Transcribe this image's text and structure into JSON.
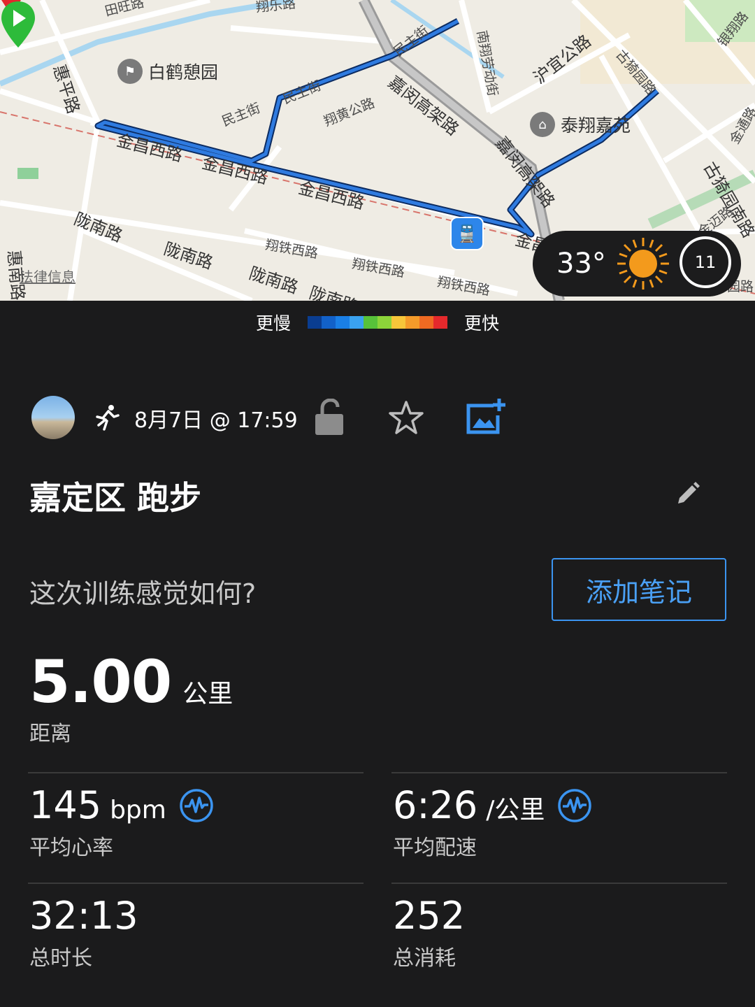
{
  "map": {
    "labels": [
      "田旺路",
      "翔乐路",
      "惠平路",
      "民主街",
      "民主街",
      "民主街",
      "翔黄公路",
      "嘉闵高架路",
      "南翔劳动街",
      "沪宜公路",
      "古猗园路",
      "银翔路",
      "金通路",
      "古猗园南路",
      "金迈路",
      "金昌西路",
      "金昌西路",
      "金昌西路",
      "金昌",
      "陇南路",
      "陇南路",
      "陇南路",
      "陇南路",
      "翔铁西路",
      "翔铁西路",
      "翔铁西路",
      "惠南路",
      "嘉闵高架路",
      "园路"
    ],
    "poi_baihe": "白鹤憩园",
    "poi_taixiang": "泰翔嘉苑",
    "legal": "法律信息",
    "route_color": "#1d5fc4"
  },
  "weather": {
    "temperature": "33°",
    "wind": "11",
    "icon": "sun-icon"
  },
  "pace_scale": {
    "slower": "更慢",
    "faster": "更快",
    "colors": [
      "#0a3d91",
      "#1261c9",
      "#1a7fe6",
      "#3aa2f0",
      "#57c23a",
      "#8cd43a",
      "#f7c63a",
      "#f59b2a",
      "#ef6a22",
      "#e5292c"
    ]
  },
  "activity": {
    "date_time": "8月7日 @ 17:59",
    "title": "嘉定区 跑步",
    "feel_prompt": "这次训练感觉如何?",
    "add_note": "添加笔记",
    "distance": {
      "value": "5.00",
      "unit": "公里",
      "label": "距离"
    },
    "stats": [
      {
        "value": "145",
        "unit": "bpm",
        "label": "平均心率",
        "icon": "heart-rate-icon"
      },
      {
        "value": "6:26",
        "unit": "/公里",
        "label": "平均配速",
        "icon": "heart-rate-icon"
      },
      {
        "value": "32:13",
        "unit": "",
        "label": "总时长"
      },
      {
        "value": "252",
        "unit": "",
        "label": "总消耗"
      }
    ]
  },
  "colors": {
    "accent": "#3b94f0",
    "background": "#1b1b1c",
    "start": "#2dbb3a",
    "end": "#e2262c"
  }
}
